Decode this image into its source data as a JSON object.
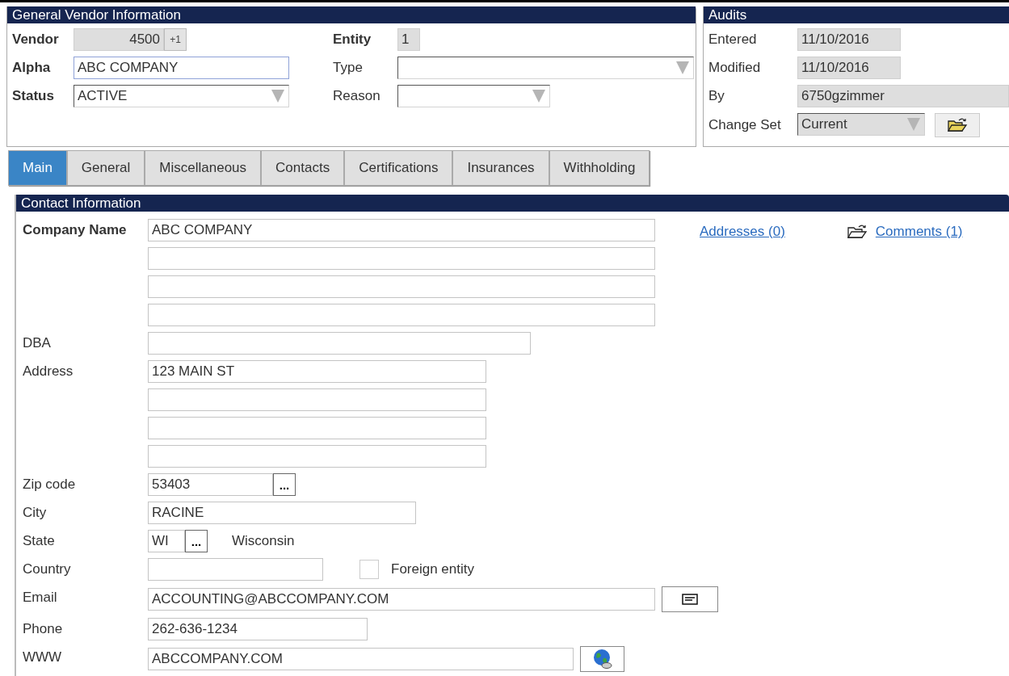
{
  "general_vendor_information": {
    "title": "General Vendor Information",
    "left_fields": [
      {
        "label": "Vendor",
        "bold": true,
        "kind": "readonly_number",
        "value": "4500",
        "button": "+1"
      },
      {
        "label": "Alpha",
        "bold": true,
        "kind": "text",
        "value": "ABC COMPANY",
        "focused": true
      },
      {
        "label": "Status",
        "bold": true,
        "kind": "select",
        "value": "ACTIVE"
      }
    ],
    "right_fields": [
      {
        "label": "Entity",
        "bold": true,
        "kind": "readonly",
        "value": "1"
      },
      {
        "label": "Type",
        "bold": false,
        "kind": "select_wide"
      },
      {
        "label": "Reason",
        "bold": false,
        "kind": "select"
      }
    ]
  },
  "audits": {
    "title": "Audits",
    "fields": [
      {
        "label": "Entered",
        "kind": "readonly",
        "value": "11/10/2016"
      },
      {
        "label": "Modified",
        "kind": "readonly",
        "value": "11/10/2016"
      },
      {
        "label": "By",
        "kind": "readonly_wide",
        "value": "6750gzimmer"
      },
      {
        "label": "Change Set",
        "kind": "select_readonly",
        "value": "Current"
      }
    ]
  },
  "tabs": [
    {
      "label": "Main",
      "selected": true
    },
    {
      "label": "General",
      "selected": false
    },
    {
      "label": "Miscellaneous",
      "selected": false
    },
    {
      "label": "Contacts",
      "selected": false
    },
    {
      "label": "Certifications",
      "selected": false
    },
    {
      "label": "Insurances",
      "selected": false
    },
    {
      "label": "Withholding",
      "selected": false
    }
  ],
  "contact_information": {
    "title": "Contact Information",
    "links": [
      {
        "label": "Addresses (0)",
        "icon": false
      },
      {
        "label": "Comments (1)",
        "icon": true
      }
    ],
    "rows": [
      {
        "kind": "multiline",
        "label": "Company Name",
        "bold": true,
        "value": "ABC COMPANY"
      },
      {
        "kind": "text",
        "label": "DBA",
        "bold": false
      },
      {
        "kind": "multiline",
        "label": "Address",
        "bold": false,
        "value": "123 MAIN ST"
      },
      {
        "kind": "lookup",
        "label": "Zip code",
        "bold": false,
        "value": "53403",
        "button": "..."
      },
      {
        "kind": "text",
        "label": "City",
        "bold": false,
        "value": "RACINE"
      },
      {
        "kind": "lookup",
        "label": "State",
        "bold": false,
        "value": "WI",
        "button": "...",
        "note": "Wisconsin"
      },
      {
        "kind": "checkbox_row",
        "label": "Country",
        "bold": false,
        "check_label": "Foreign entity",
        "checked": false
      },
      {
        "kind": "email",
        "label": "Email",
        "bold": false,
        "value": "ACCOUNTING@ABCCOMPANY.COM"
      },
      {
        "kind": "text",
        "label": "Phone",
        "bold": false,
        "value": "262-636-1234"
      },
      {
        "kind": "website",
        "label": "WWW",
        "bold": false,
        "value": "ABCCOMPANY.COM"
      }
    ]
  }
}
